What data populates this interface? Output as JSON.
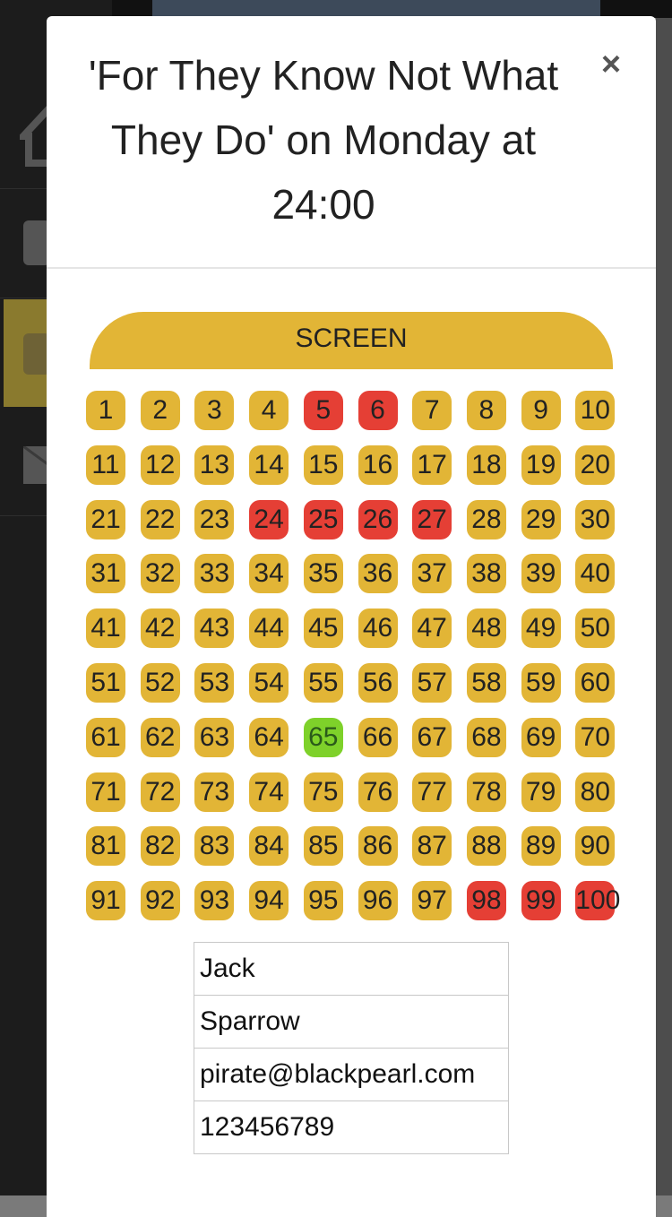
{
  "modal": {
    "title_line1": "'For They Know Not What",
    "title_line2": "They Do' on Monday at",
    "title_line3": "24:00",
    "close_label": "×"
  },
  "screen_label": "SCREEN",
  "seats": {
    "count": 100,
    "per_row": 10,
    "taken": [
      5,
      6,
      24,
      25,
      26,
      27,
      98,
      99,
      100
    ],
    "selected": [
      65
    ]
  },
  "form": {
    "first_name": "Jack",
    "last_name": "Sparrow",
    "email": "pirate@blackpearl.com",
    "phone": "123456789"
  },
  "colors": {
    "seat_available": "#e2b536",
    "seat_taken": "#e53f35",
    "seat_selected": "#7ed12a"
  }
}
